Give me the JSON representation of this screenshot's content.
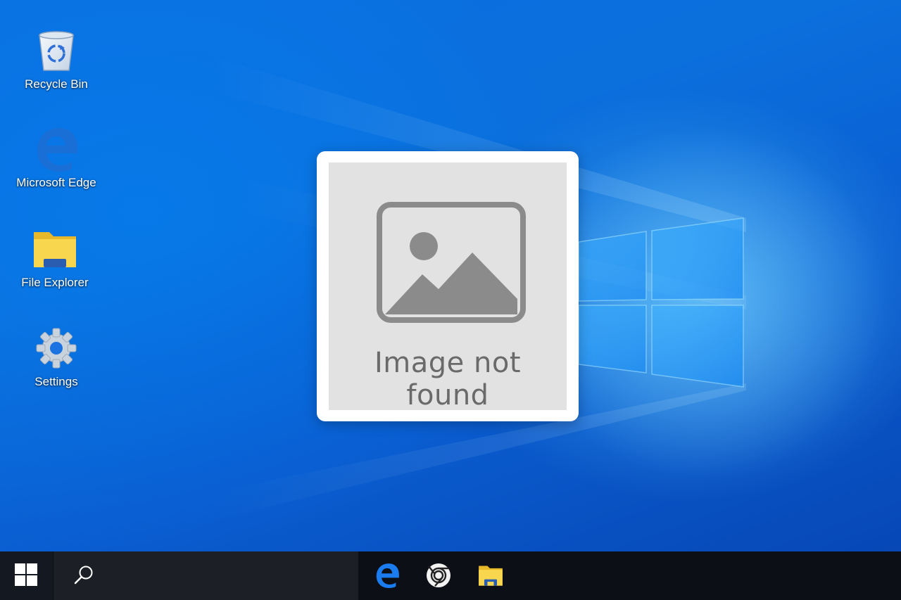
{
  "desktop": {
    "icons": [
      {
        "label": "Recycle Bin",
        "icon": "recycle-bin-icon"
      },
      {
        "label": "Microsoft Edge",
        "icon": "edge-icon"
      },
      {
        "label": "File Explorer",
        "icon": "folder-icon"
      },
      {
        "label": "Settings",
        "icon": "gear-icon"
      }
    ],
    "placeholder": {
      "caption": "Image not found",
      "icon": "image-icon"
    },
    "colors": {
      "wallpaper": "#0a6fe0",
      "taskbar": "#0c0f16"
    }
  },
  "taskbar": {
    "start_icon": "windows-logo-icon",
    "search_icon": "search-icon",
    "search_placeholder": "",
    "pinned_apps": [
      {
        "name": "Microsoft Edge",
        "icon": "edge-icon"
      },
      {
        "name": "Google Chrome",
        "icon": "chrome-icon"
      },
      {
        "name": "File Explorer",
        "icon": "folder-icon"
      }
    ]
  }
}
